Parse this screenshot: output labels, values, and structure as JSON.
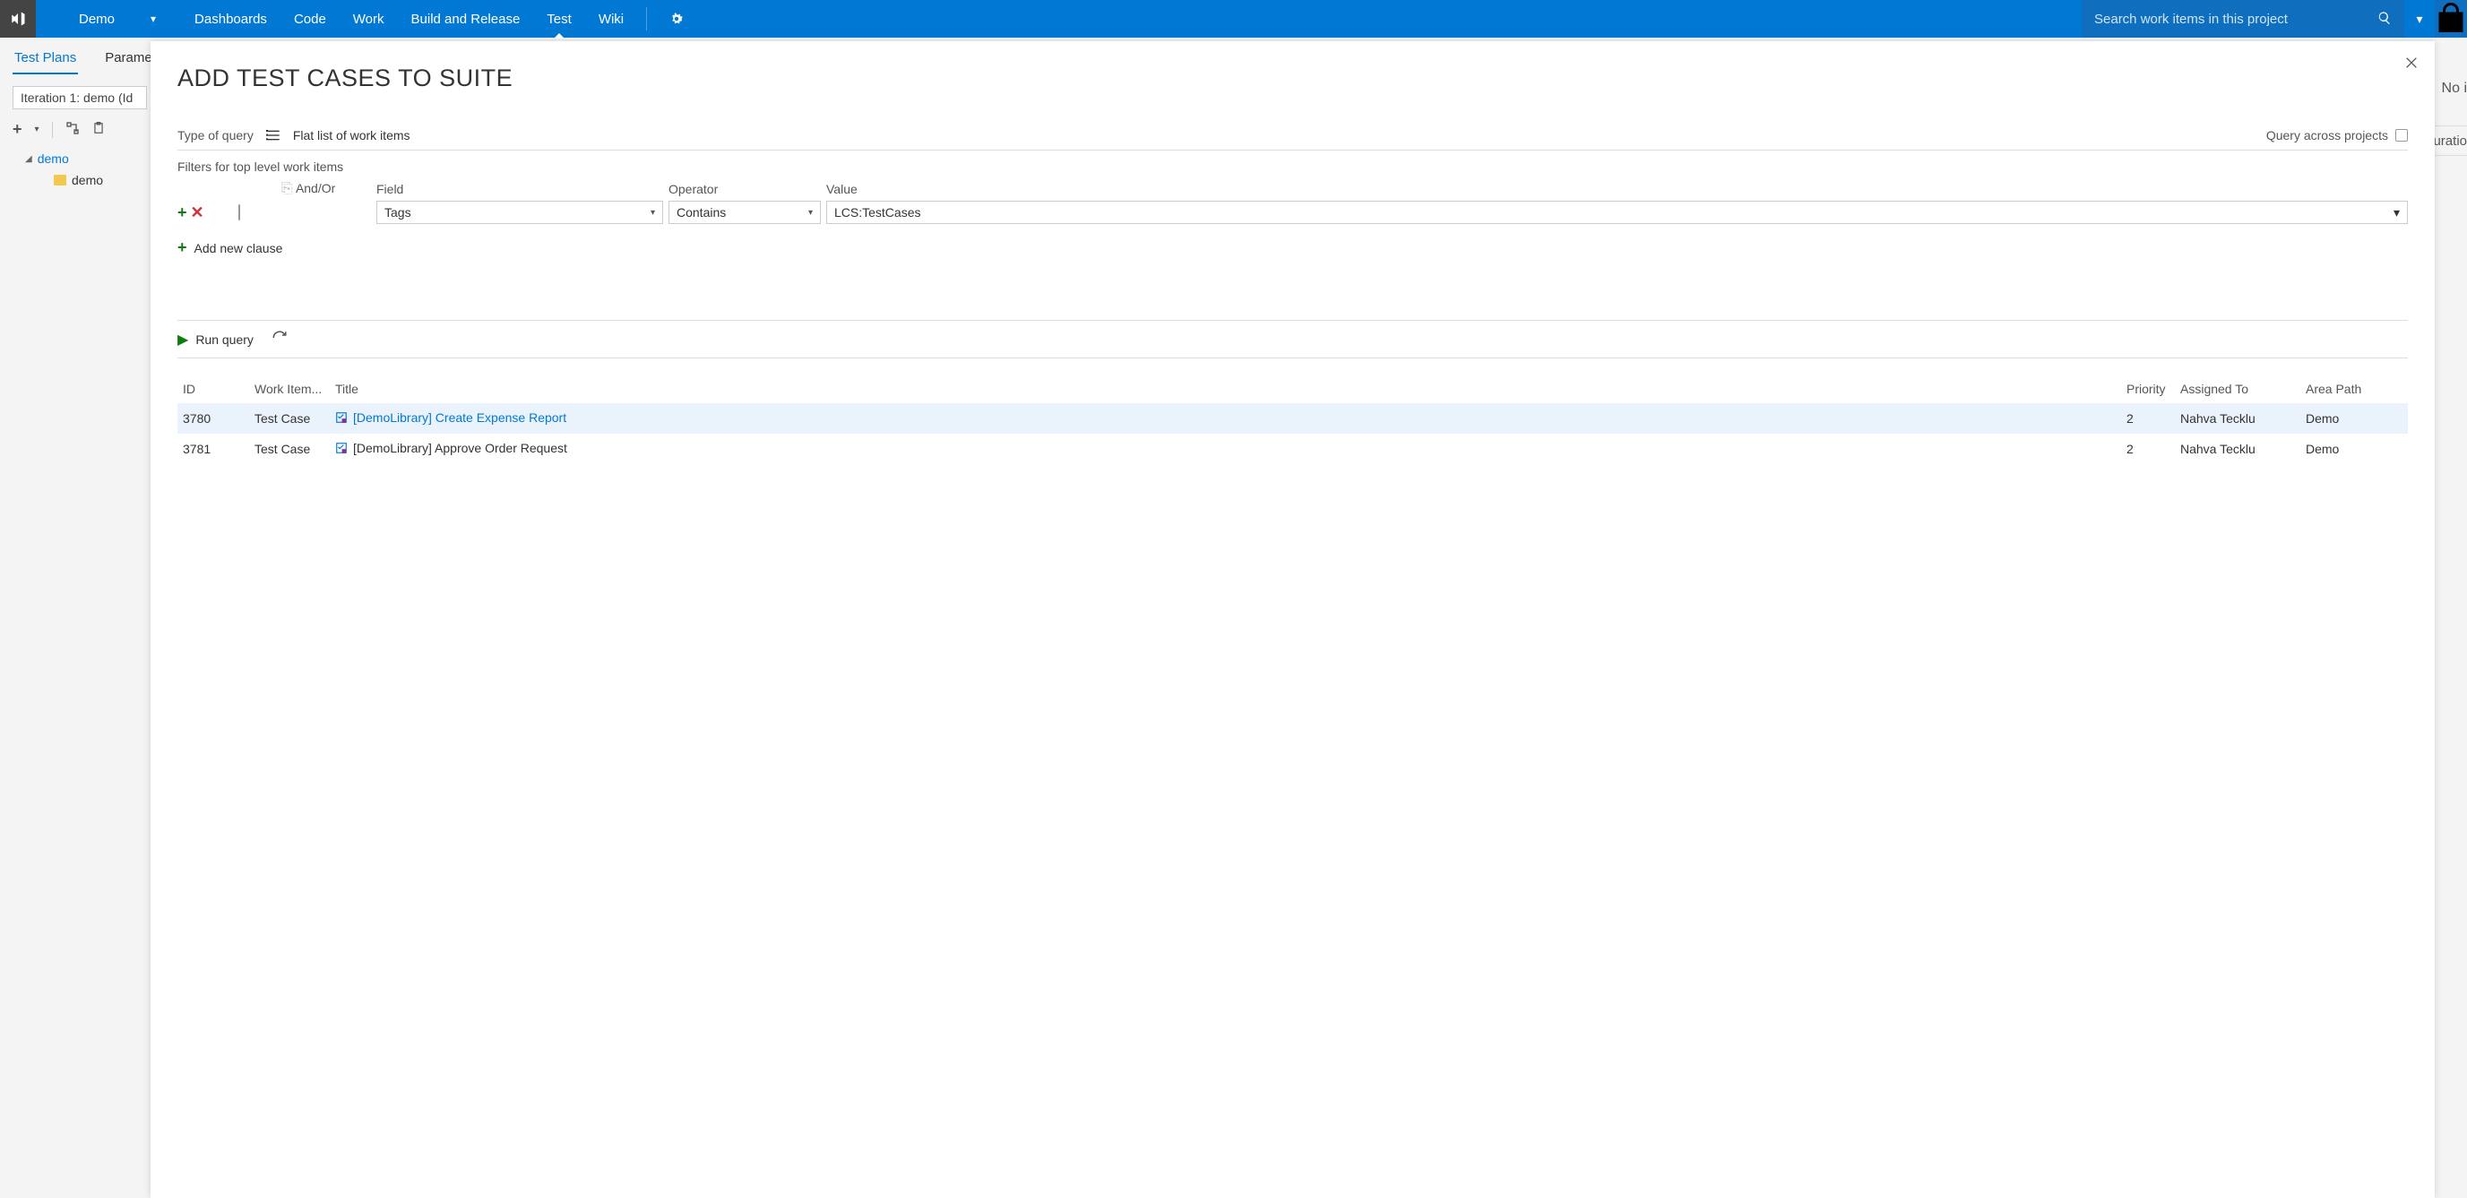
{
  "header": {
    "project": "Demo",
    "nav": [
      "Dashboards",
      "Code",
      "Work",
      "Build and Release",
      "Test",
      "Wiki"
    ],
    "active_nav": "Test",
    "search_placeholder": "Search work items in this project"
  },
  "subtabs": {
    "items": [
      "Test Plans",
      "Parame"
    ],
    "active": "Test Plans"
  },
  "leftpanel": {
    "iteration": "Iteration 1: demo (Id",
    "tree_root": "demo",
    "tree_child": "demo"
  },
  "right_cut": {
    "line1": "No i",
    "line2": "uratio"
  },
  "dialog": {
    "title": "ADD TEST CASES TO SUITE",
    "type_of_query_label": "Type of query",
    "type_of_query_value": "Flat list of work items",
    "query_across_label": "Query across projects",
    "filters_label": "Filters for top level work items",
    "columns": {
      "andor": "And/Or",
      "field": "Field",
      "operator": "Operator",
      "value": "Value"
    },
    "filter": {
      "field": "Tags",
      "operator": "Contains",
      "value": "LCS:TestCases"
    },
    "add_clause": "Add new clause",
    "run_query": "Run query",
    "results": {
      "headers": {
        "id": "ID",
        "wit": "Work Item...",
        "title": "Title",
        "priority": "Priority",
        "assigned": "Assigned To",
        "area": "Area Path"
      },
      "rows": [
        {
          "id": "3780",
          "wit": "Test Case",
          "title": "[DemoLibrary] Create Expense Report",
          "priority": "2",
          "assigned": "Nahva Tecklu",
          "area": "Demo",
          "selected": true
        },
        {
          "id": "3781",
          "wit": "Test Case",
          "title": "[DemoLibrary] Approve Order Request",
          "priority": "2",
          "assigned": "Nahva Tecklu",
          "area": "Demo",
          "selected": false
        }
      ]
    }
  }
}
